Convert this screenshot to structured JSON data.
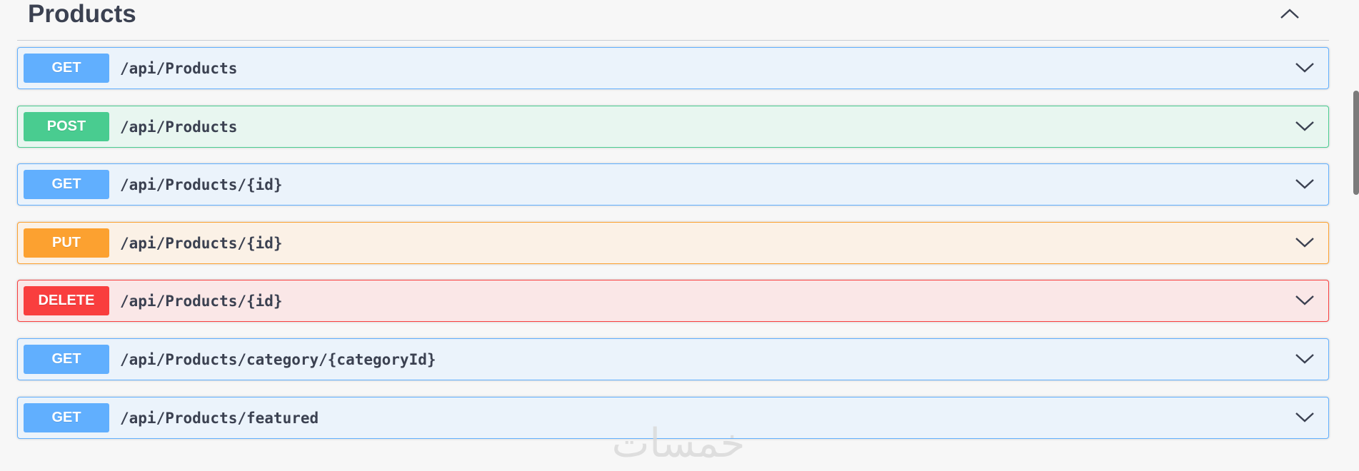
{
  "section": {
    "title": "Products",
    "expanded": true
  },
  "operations": [
    {
      "method": "GET",
      "path": "/api/Products",
      "color": "#61affe"
    },
    {
      "method": "POST",
      "path": "/api/Products",
      "color": "#49cc90"
    },
    {
      "method": "GET",
      "path": "/api/Products/{id}",
      "color": "#61affe"
    },
    {
      "method": "PUT",
      "path": "/api/Products/{id}",
      "color": "#fca130"
    },
    {
      "method": "DELETE",
      "path": "/api/Products/{id}",
      "color": "#f93e3e"
    },
    {
      "method": "GET",
      "path": "/api/Products/category/{categoryId}",
      "color": "#61affe"
    },
    {
      "method": "GET",
      "path": "/api/Products/featured",
      "color": "#61affe"
    }
  ],
  "icons": {
    "collapse": "chevron-up-icon",
    "expand": "chevron-down-icon"
  },
  "watermark": {
    "text": "خمسات"
  }
}
